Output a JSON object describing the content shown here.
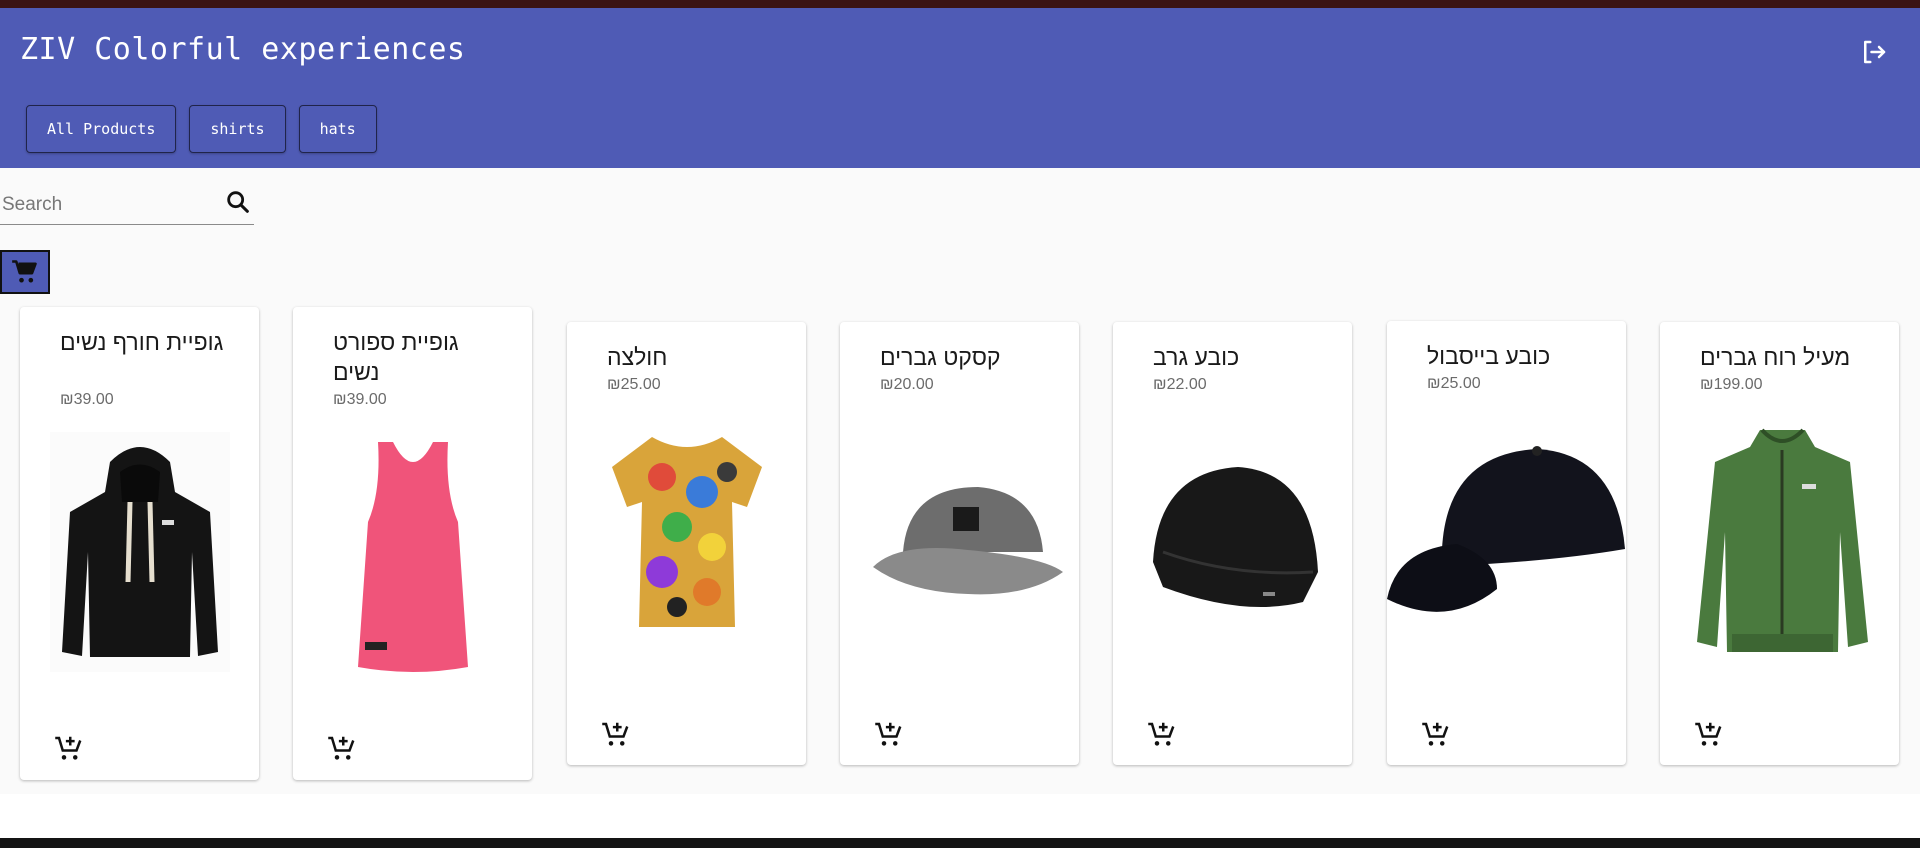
{
  "app": {
    "title": "ZIV Colorful experiences"
  },
  "nav": {
    "items": [
      "All Products",
      "shirts",
      "hats"
    ]
  },
  "search": {
    "placeholder": "Search"
  },
  "currency_symbol": "₪",
  "products": [
    {
      "name": "גופיית חורף נשים",
      "price": "₪39.00",
      "image": "black-hoodie"
    },
    {
      "name": "גופיית ספורט נשים",
      "price": "₪39.00",
      "image": "pink-tank-top"
    },
    {
      "name": "חולצה",
      "price": "₪25.00",
      "image": "cartoon-print-tshirt"
    },
    {
      "name": "קסקט גברים",
      "price": "₪20.00",
      "image": "grey-cap"
    },
    {
      "name": "כובע גרב",
      "price": "₪22.00",
      "image": "black-beanie"
    },
    {
      "name": "כובע בייסבול",
      "price": "₪25.00",
      "image": "black-baseball-cap"
    },
    {
      "name": "מעיל רוח גברים",
      "price": "₪199.00",
      "image": "green-jacket"
    }
  ],
  "colors": {
    "header": "#4f5bb5",
    "background": "#fafafa",
    "card": "#ffffff"
  },
  "icons": {
    "logout": "logout-icon",
    "search": "search-icon",
    "cart": "shopping-cart-icon",
    "add_to_cart": "add-shopping-cart-icon"
  }
}
